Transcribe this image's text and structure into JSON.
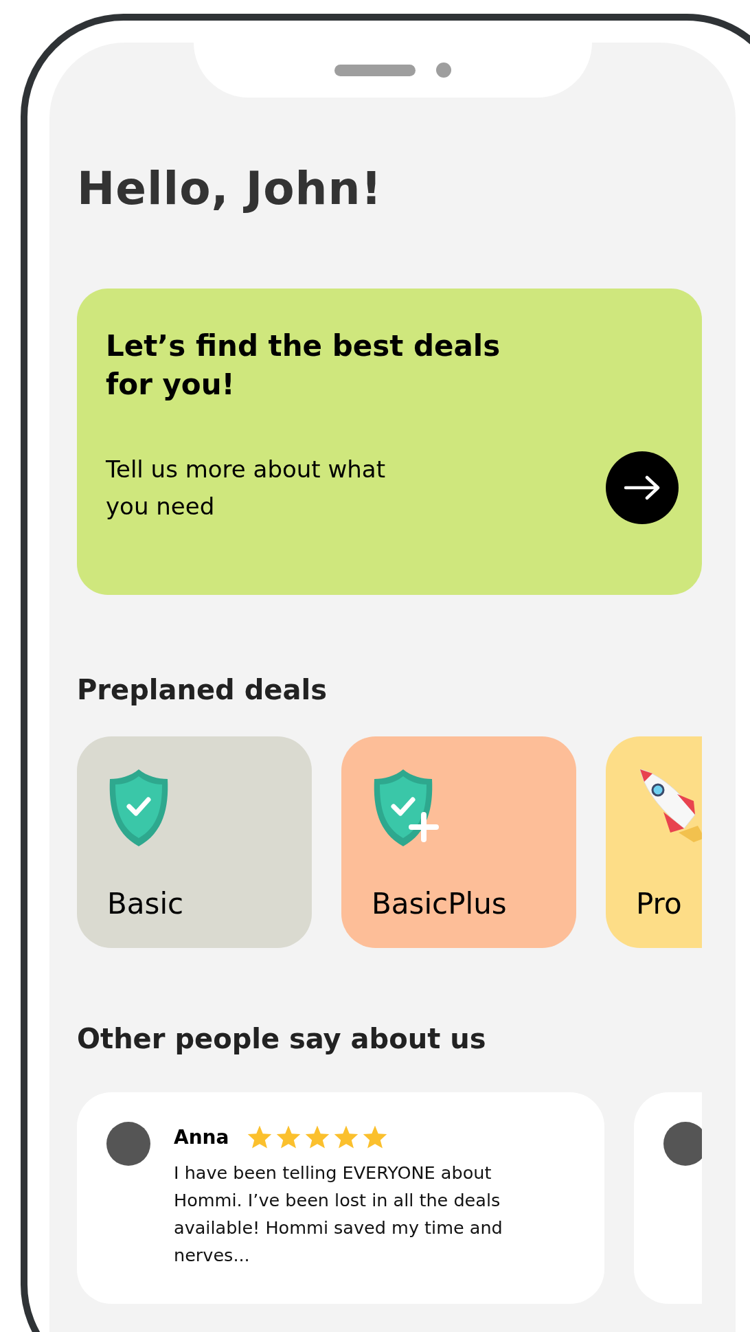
{
  "greeting": "Hello, John!",
  "promo": {
    "title": "Let’s find the best deals for you!",
    "subtitle": "Tell us more about what you need"
  },
  "deals_heading": "Preplaned deals",
  "deals": [
    {
      "label": "Basic",
      "kind": "shield",
      "color": "#dadad0"
    },
    {
      "label": "BasicPlus",
      "kind": "shield-plus",
      "color": "#fdbe98"
    },
    {
      "label": "Pro",
      "kind": "rocket",
      "color": "#fddd87"
    }
  ],
  "reviews_heading": "Other people say about us",
  "reviews": [
    {
      "kind": "full",
      "name": "Anna",
      "stars": 5,
      "text": "I have been telling EVERYONE about Hommi. I’ve been lost in all the deals available! Hommi saved my time and nerves..."
    },
    {
      "kind": "cut"
    }
  ]
}
